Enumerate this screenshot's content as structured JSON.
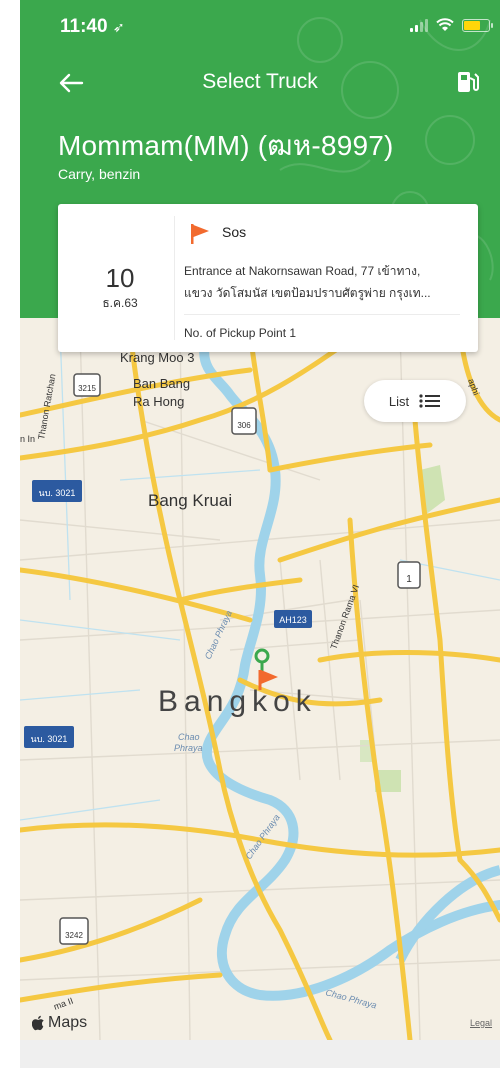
{
  "status_bar": {
    "time": "11:40"
  },
  "header": {
    "title": "Select Truck",
    "truck_name": "Mommam(MM) (ฒห-8997)",
    "truck_sub": "Carry, benzin"
  },
  "card": {
    "day": "10",
    "month": "ธ.ค.63",
    "label": "Sos",
    "address_line1": "Entrance at Nakornsawan Road, 77 เข้าทาง,",
    "address_line2": "แขวง วัดโสมนัส เขตป้อมปราบศัตรูพ่าย กรุงเท...",
    "pickup": "No. of Pickup Point 1"
  },
  "list_button": {
    "label": "List"
  },
  "map": {
    "labels": {
      "krang": "Krang Moo 3",
      "ban_bang": "Ban Bang",
      "ra_hong": "Ra Hong",
      "bang_kruai": "Bang Kruai",
      "bangkok": "Bangkok",
      "chao_phraya": "Chao",
      "chao_phraya2": "Phraya",
      "river_label1": "Chao Phraya",
      "river_label2": "Chao Phraya",
      "river_label3": "Chao Phraya",
      "thanon_ratchan": "Thanon Ratchan",
      "thanon_rama": "Thanon Rama VI",
      "ma_ii": "ma II",
      "in": "n In",
      "aphi": "aphi"
    },
    "shields": {
      "r3215": "3215",
      "r306": "306",
      "r3021a": "นบ. 3021",
      "r3021b": "นบ. 3021",
      "ah123": "AH123",
      "r1": "1",
      "r3242": "3242"
    },
    "attribution": "Maps",
    "legal": "Legal"
  },
  "colors": {
    "header_green": "#3ba84d",
    "flag_orange": "#f26a2e",
    "map_bg": "#f4efe4",
    "river": "#9fd3ea",
    "road_yellow": "#f5c842"
  }
}
